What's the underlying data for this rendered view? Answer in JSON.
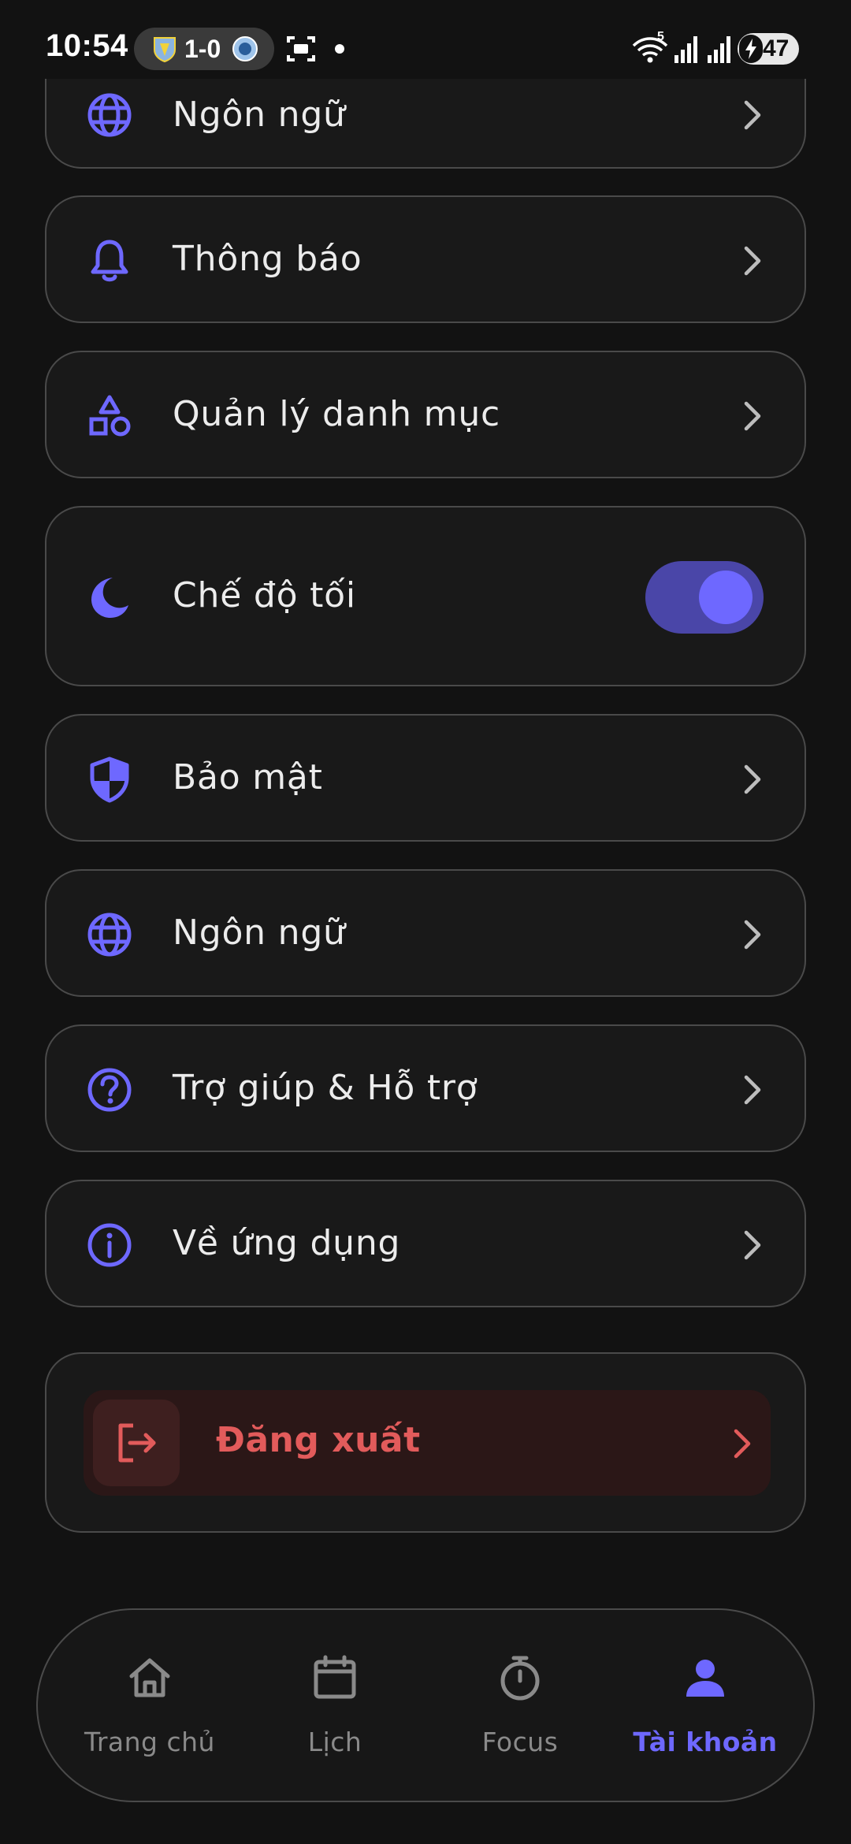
{
  "status_bar": {
    "time": "10:54",
    "match_score": "1-0",
    "battery": "47",
    "network_label": "5"
  },
  "settings": {
    "items": [
      {
        "label": "Ngôn ngữ",
        "icon": "globe-icon"
      },
      {
        "label": "Thông báo",
        "icon": "bell-icon"
      },
      {
        "label": "Quản lý danh mục",
        "icon": "shapes-icon"
      },
      {
        "label": "Chế độ tối",
        "icon": "moon-icon",
        "toggle_on": true
      },
      {
        "label": "Bảo mật",
        "icon": "shield-icon"
      },
      {
        "label": "Ngôn ngữ",
        "icon": "globe-icon"
      },
      {
        "label": "Trợ giúp & Hỗ trợ",
        "icon": "help-circle-icon"
      },
      {
        "label": "Về ứng dụng",
        "icon": "info-icon"
      }
    ],
    "logout_label": "Đăng xuất"
  },
  "bottom_nav": {
    "items": [
      {
        "label": "Trang chủ",
        "icon": "home-icon",
        "active": false
      },
      {
        "label": "Lịch",
        "icon": "calendar-icon",
        "active": false
      },
      {
        "label": "Focus",
        "icon": "timer-icon",
        "active": false
      },
      {
        "label": "Tài khoản",
        "icon": "user-icon",
        "active": true
      }
    ]
  },
  "colors": {
    "accent": "#6e68ff",
    "danger": "#e25b5b",
    "background": "#121212",
    "card_border": "#4a4a4a"
  }
}
